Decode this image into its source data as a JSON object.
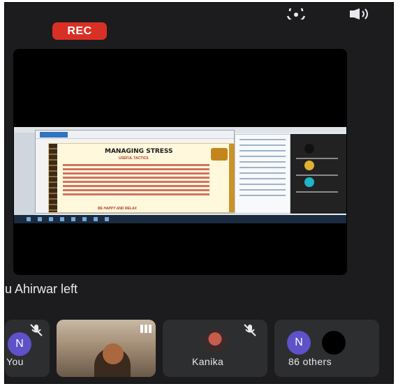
{
  "recording": {
    "label": "REC",
    "color": "#d93025"
  },
  "icons": {
    "camera_switch": "camera-switch-icon",
    "speaker": "speaker-icon",
    "microphone_off": "microphone-off-icon",
    "audio_level": "audio-level-icon"
  },
  "presentation": {
    "slide_title": "MANAGING STRESS",
    "slide_subtitle": "USEFUL TACTICS",
    "slide_footer": "BE HAPPY AND RELAX"
  },
  "notification": {
    "text": "u Ahirwar left"
  },
  "participants": [
    {
      "name": "You",
      "avatar_letter": "N",
      "muted": true
    },
    {
      "name": "",
      "video": true,
      "speaking": true
    },
    {
      "name": "Kanika",
      "muted": true
    },
    {
      "name": "86 others",
      "avatar_letter": "N"
    }
  ],
  "colors": {
    "background": "#1c1c1e",
    "tile": "#2d2e30",
    "avatar_purple": "#5f51c8",
    "text": "#e8eaed"
  }
}
